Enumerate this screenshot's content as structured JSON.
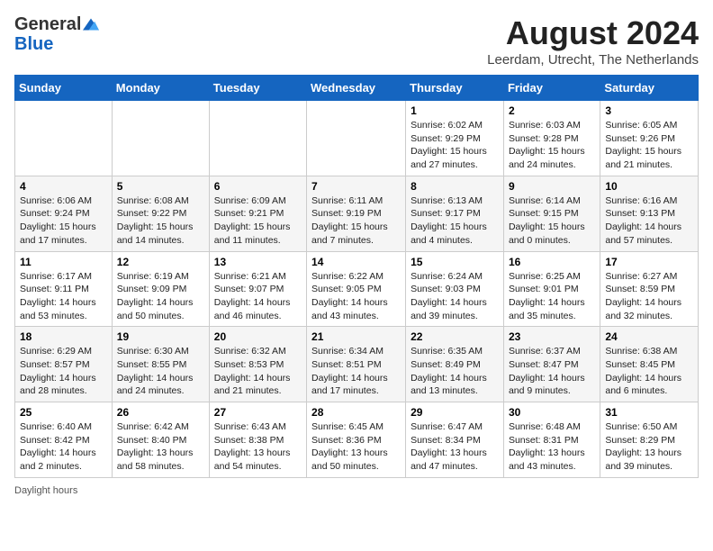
{
  "header": {
    "logo_general": "General",
    "logo_blue": "Blue",
    "main_title": "August 2024",
    "subtitle": "Leerdam, Utrecht, The Netherlands"
  },
  "days_of_week": [
    "Sunday",
    "Monday",
    "Tuesday",
    "Wednesday",
    "Thursday",
    "Friday",
    "Saturday"
  ],
  "weeks": [
    [
      {
        "day": "",
        "info": ""
      },
      {
        "day": "",
        "info": ""
      },
      {
        "day": "",
        "info": ""
      },
      {
        "day": "",
        "info": ""
      },
      {
        "day": "1",
        "info": "Sunrise: 6:02 AM\nSunset: 9:29 PM\nDaylight: 15 hours and 27 minutes."
      },
      {
        "day": "2",
        "info": "Sunrise: 6:03 AM\nSunset: 9:28 PM\nDaylight: 15 hours and 24 minutes."
      },
      {
        "day": "3",
        "info": "Sunrise: 6:05 AM\nSunset: 9:26 PM\nDaylight: 15 hours and 21 minutes."
      }
    ],
    [
      {
        "day": "4",
        "info": "Sunrise: 6:06 AM\nSunset: 9:24 PM\nDaylight: 15 hours and 17 minutes."
      },
      {
        "day": "5",
        "info": "Sunrise: 6:08 AM\nSunset: 9:22 PM\nDaylight: 15 hours and 14 minutes."
      },
      {
        "day": "6",
        "info": "Sunrise: 6:09 AM\nSunset: 9:21 PM\nDaylight: 15 hours and 11 minutes."
      },
      {
        "day": "7",
        "info": "Sunrise: 6:11 AM\nSunset: 9:19 PM\nDaylight: 15 hours and 7 minutes."
      },
      {
        "day": "8",
        "info": "Sunrise: 6:13 AM\nSunset: 9:17 PM\nDaylight: 15 hours and 4 minutes."
      },
      {
        "day": "9",
        "info": "Sunrise: 6:14 AM\nSunset: 9:15 PM\nDaylight: 15 hours and 0 minutes."
      },
      {
        "day": "10",
        "info": "Sunrise: 6:16 AM\nSunset: 9:13 PM\nDaylight: 14 hours and 57 minutes."
      }
    ],
    [
      {
        "day": "11",
        "info": "Sunrise: 6:17 AM\nSunset: 9:11 PM\nDaylight: 14 hours and 53 minutes."
      },
      {
        "day": "12",
        "info": "Sunrise: 6:19 AM\nSunset: 9:09 PM\nDaylight: 14 hours and 50 minutes."
      },
      {
        "day": "13",
        "info": "Sunrise: 6:21 AM\nSunset: 9:07 PM\nDaylight: 14 hours and 46 minutes."
      },
      {
        "day": "14",
        "info": "Sunrise: 6:22 AM\nSunset: 9:05 PM\nDaylight: 14 hours and 43 minutes."
      },
      {
        "day": "15",
        "info": "Sunrise: 6:24 AM\nSunset: 9:03 PM\nDaylight: 14 hours and 39 minutes."
      },
      {
        "day": "16",
        "info": "Sunrise: 6:25 AM\nSunset: 9:01 PM\nDaylight: 14 hours and 35 minutes."
      },
      {
        "day": "17",
        "info": "Sunrise: 6:27 AM\nSunset: 8:59 PM\nDaylight: 14 hours and 32 minutes."
      }
    ],
    [
      {
        "day": "18",
        "info": "Sunrise: 6:29 AM\nSunset: 8:57 PM\nDaylight: 14 hours and 28 minutes."
      },
      {
        "day": "19",
        "info": "Sunrise: 6:30 AM\nSunset: 8:55 PM\nDaylight: 14 hours and 24 minutes."
      },
      {
        "day": "20",
        "info": "Sunrise: 6:32 AM\nSunset: 8:53 PM\nDaylight: 14 hours and 21 minutes."
      },
      {
        "day": "21",
        "info": "Sunrise: 6:34 AM\nSunset: 8:51 PM\nDaylight: 14 hours and 17 minutes."
      },
      {
        "day": "22",
        "info": "Sunrise: 6:35 AM\nSunset: 8:49 PM\nDaylight: 14 hours and 13 minutes."
      },
      {
        "day": "23",
        "info": "Sunrise: 6:37 AM\nSunset: 8:47 PM\nDaylight: 14 hours and 9 minutes."
      },
      {
        "day": "24",
        "info": "Sunrise: 6:38 AM\nSunset: 8:45 PM\nDaylight: 14 hours and 6 minutes."
      }
    ],
    [
      {
        "day": "25",
        "info": "Sunrise: 6:40 AM\nSunset: 8:42 PM\nDaylight: 14 hours and 2 minutes."
      },
      {
        "day": "26",
        "info": "Sunrise: 6:42 AM\nSunset: 8:40 PM\nDaylight: 13 hours and 58 minutes."
      },
      {
        "day": "27",
        "info": "Sunrise: 6:43 AM\nSunset: 8:38 PM\nDaylight: 13 hours and 54 minutes."
      },
      {
        "day": "28",
        "info": "Sunrise: 6:45 AM\nSunset: 8:36 PM\nDaylight: 13 hours and 50 minutes."
      },
      {
        "day": "29",
        "info": "Sunrise: 6:47 AM\nSunset: 8:34 PM\nDaylight: 13 hours and 47 minutes."
      },
      {
        "day": "30",
        "info": "Sunrise: 6:48 AM\nSunset: 8:31 PM\nDaylight: 13 hours and 43 minutes."
      },
      {
        "day": "31",
        "info": "Sunrise: 6:50 AM\nSunset: 8:29 PM\nDaylight: 13 hours and 39 minutes."
      }
    ]
  ],
  "footer": {
    "note": "Daylight hours"
  }
}
